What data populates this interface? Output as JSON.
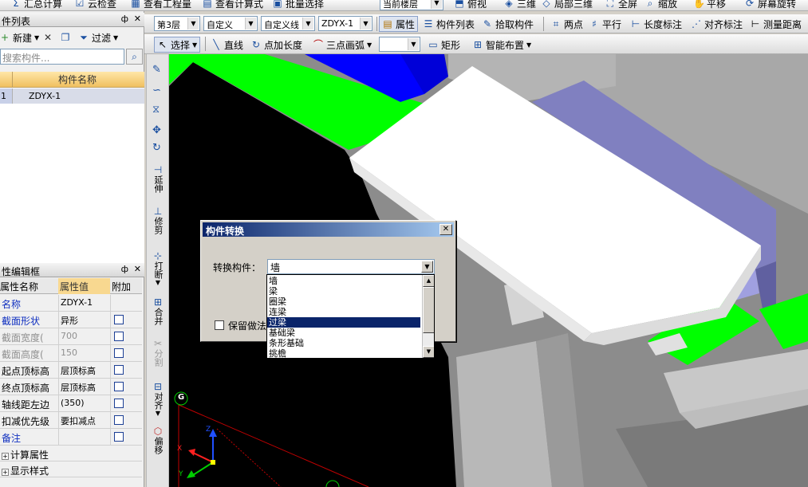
{
  "top_toolbar": {
    "items": [
      "汇总计算",
      "云检查",
      "查看工程量",
      "查看计算式",
      "批量选择"
    ],
    "floor_scope": "当前楼层",
    "view_items": [
      "俯视",
      "三维",
      "局部三维",
      "全屏",
      "缩放",
      "平移",
      "屏幕旋转"
    ]
  },
  "component_list": {
    "title": "件列表",
    "new_label": "新建",
    "filter_label": "过滤",
    "search_placeholder": "搜索构件...",
    "column_header": "构件名称",
    "rows": [
      {
        "index": "1",
        "name": "ZDYX-1"
      }
    ]
  },
  "property_editor": {
    "title": "性编辑框",
    "headers": [
      "属性名称",
      "属性值",
      "附加"
    ],
    "rows": [
      {
        "name": "名称",
        "value": "ZDYX-1",
        "style": "blue"
      },
      {
        "name": "截面形状",
        "value": "异形",
        "style": "blue"
      },
      {
        "name": "截面宽度(",
        "value": "700",
        "style": "gray"
      },
      {
        "name": "截面高度(",
        "value": "150",
        "style": "gray"
      },
      {
        "name": "起点顶标高",
        "value": "层顶标高",
        "style": "normal"
      },
      {
        "name": "终点顶标高",
        "value": "层顶标高",
        "style": "normal"
      },
      {
        "name": "轴线距左边",
        "value": "(350)",
        "style": "normal"
      },
      {
        "name": "扣减优先级",
        "value": "要扣减点",
        "style": "normal"
      },
      {
        "name": "备注",
        "value": "",
        "style": "blue"
      }
    ],
    "groups": [
      "计算属性",
      "显示样式"
    ]
  },
  "toolbar_row1": {
    "floor": "第3层",
    "category": "自定义",
    "type": "自定义线",
    "component": "ZDYX-1",
    "buttons": [
      "属性",
      "构件列表",
      "拾取构件",
      "两点",
      "平行",
      "长度标注",
      "对齐标注",
      "测量距离"
    ]
  },
  "toolbar_row2": {
    "buttons": [
      "选择",
      "直线",
      "点加长度",
      "三点画弧",
      "矩形",
      "智能布置"
    ],
    "empty_combo": ""
  },
  "vertical_tools": [
    "延伸",
    "修剪",
    "打断",
    "合并",
    "分割",
    "对齐",
    "偏移"
  ],
  "dialog": {
    "title": "构件转换",
    "label": "转换构件：",
    "selected": "墙",
    "options": [
      "墙",
      "梁",
      "圈梁",
      "连梁",
      "过梁",
      "基础梁",
      "条形基础",
      "挑檐"
    ],
    "highlighted_index": 4,
    "checkbox_label": "保留做法"
  },
  "canvas": {
    "axis_marker": "G",
    "axes": [
      "Z",
      "X",
      "Y"
    ]
  },
  "colors": {
    "highlight": "#0a246a",
    "grid_green": "#00ff00",
    "slab_blue": "#0000ff",
    "beam_purple": "#8080c0"
  }
}
